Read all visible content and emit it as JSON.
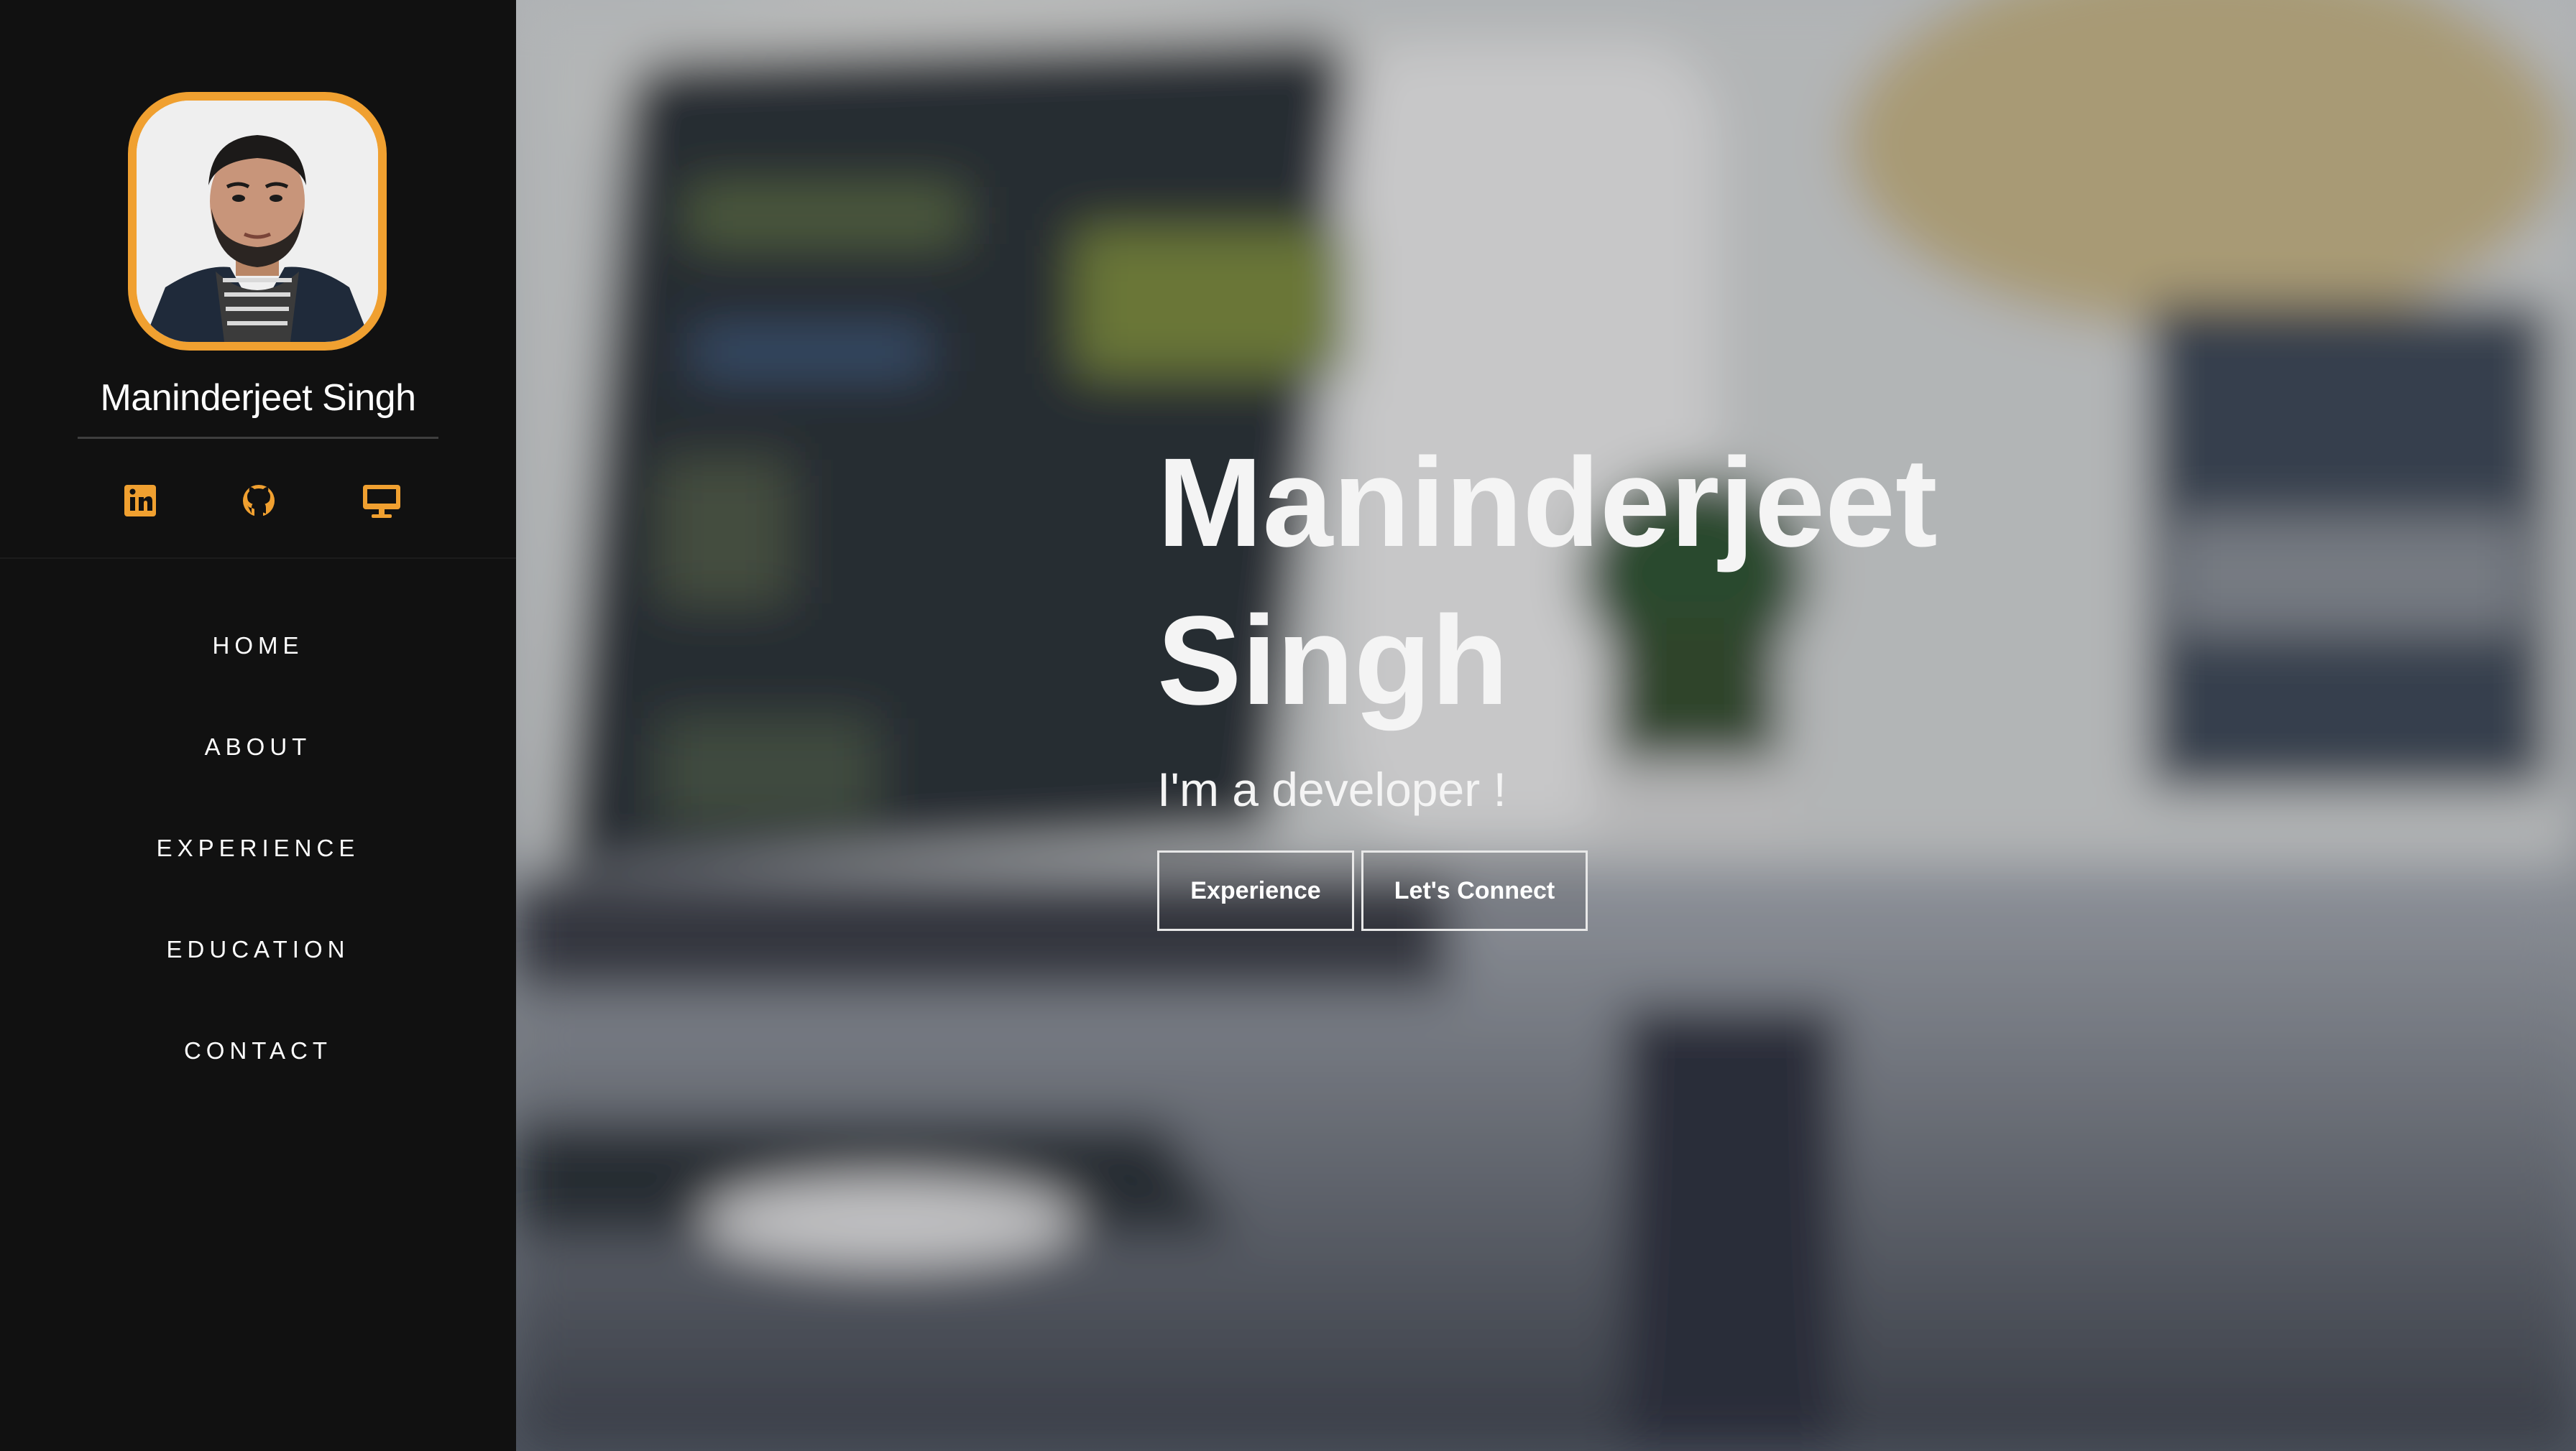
{
  "sidebar": {
    "name": "Maninderjeet Singh",
    "avatar_alt": "profile photo",
    "socials": [
      {
        "icon": "linkedin-icon"
      },
      {
        "icon": "github-icon"
      },
      {
        "icon": "monitor-icon"
      }
    ],
    "nav": [
      {
        "label": "HOME"
      },
      {
        "label": "ABOUT"
      },
      {
        "label": "EXPERIENCE"
      },
      {
        "label": "EDUCATION"
      },
      {
        "label": "CONTACT"
      }
    ]
  },
  "hero": {
    "title": "Maninderjeet Singh",
    "subtitle": "I'm a developer !",
    "buttons": {
      "experience": "Experience",
      "connect": "Let's Connect"
    },
    "background": "blurred laptop with code on desk"
  },
  "colors": {
    "accent": "#f0a030",
    "sidebar_bg": "#111111",
    "text": "#ffffff"
  }
}
